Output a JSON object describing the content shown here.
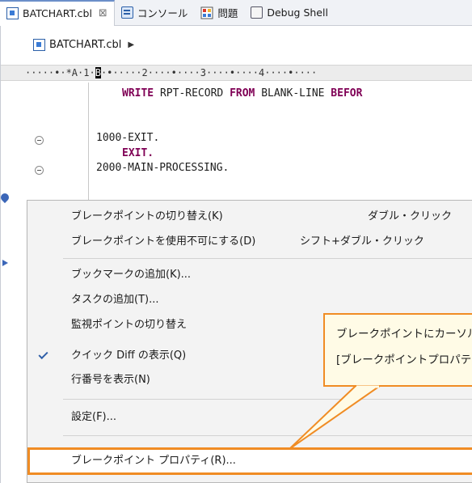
{
  "tabs": [
    {
      "label": "BATCHART.cbl",
      "icon": "cobol-file-icon",
      "active": true
    },
    {
      "label": "コンソール",
      "icon": "console-icon"
    },
    {
      "label": "問題",
      "icon": "problems-icon"
    },
    {
      "label": "Debug Shell",
      "icon": "debug-shell-icon"
    }
  ],
  "editor": {
    "breadcrumb": "BATCHART.cbl",
    "ruler_prefix": "·····•·*A·1·",
    "ruler_cursor": "B",
    "ruler_suffix": "·•·····2····•····3····•····4····•····",
    "code_lines": [
      {
        "keyword1": "WRITE",
        "text1": " RPT-RECORD ",
        "keyword2": "FROM",
        "text2": " BLANK-LINE ",
        "keyword3": "BEFOR"
      },
      {
        "text": "1000-EXIT."
      },
      {
        "keyword": "EXIT."
      },
      {
        "text": "2000-MAIN-PROCESSING."
      }
    ]
  },
  "context_menu": {
    "items": [
      {
        "label": "ブレークポイントの切り替え(K)",
        "accelerator": "ダブル・クリック"
      },
      {
        "label": "ブレークポイントを使用不可にする(D)",
        "accelerator": "シフト+ダブル・クリック"
      },
      {
        "label": "ブックマークの追加(K)..."
      },
      {
        "label": "タスクの追加(T)..."
      },
      {
        "label": "監視ポイントの切り替え"
      },
      {
        "label": "クイック Diff の表示(Q)",
        "checked": true
      },
      {
        "label": "行番号を表示(N)"
      },
      {
        "label": "設定(F)..."
      },
      {
        "label": "ブレークポイント プロパティ(R)...",
        "highlighted": true
      }
    ]
  },
  "callout": {
    "line1": "ブレークポイントにカーソルを合",
    "line2": "[ブレークポイントプロパティ(R)"
  },
  "colors": {
    "callout_border": "#f08c24",
    "callout_fill": "#fffbe6",
    "keyword": "#7f0055"
  }
}
